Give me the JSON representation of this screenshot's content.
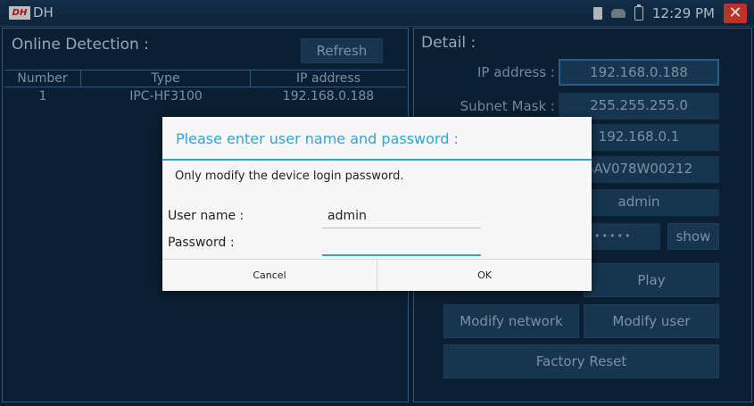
{
  "topbar": {
    "logo_text": "DH",
    "app_name": "DH",
    "time": "12:29 PM",
    "icons": [
      "sd-card-icon",
      "network-icon",
      "battery-icon",
      "close-icon"
    ],
    "close_glyph": "✕"
  },
  "online_detection": {
    "title": "Online Detection :",
    "refresh_label": "Refresh",
    "columns": [
      "Number",
      "Type",
      "IP address"
    ],
    "rows": [
      {
        "number": "1",
        "type": "IPC-HF3100",
        "ip": "192.168.0.188"
      }
    ]
  },
  "detail": {
    "title": "Detail :",
    "ip_label": "IP address :",
    "ip_value": "192.168.0.188",
    "subnet_label": "Subnet Mask :",
    "subnet_value": "255.255.255.0",
    "gateway_value": "192.168.0.1",
    "serial_value": "4AV078W00212",
    "user_value": "admin",
    "password_dots": "••••••",
    "show_label": "show",
    "play_label": "Play",
    "modify_network_label": "Modify network",
    "modify_user_label": "Modify user",
    "factory_reset_label": "Factory Reset"
  },
  "dialog": {
    "title": "Please enter user name and password :",
    "message": "Only modify the device login password.",
    "username_label": "User name :",
    "username_value": "admin",
    "password_label": "Password :",
    "password_value": "",
    "cancel_label": "Cancel",
    "ok_label": "OK"
  },
  "colors": {
    "background": "#0b2236",
    "accent": "#33a3d0",
    "close": "#d43a2e"
  }
}
